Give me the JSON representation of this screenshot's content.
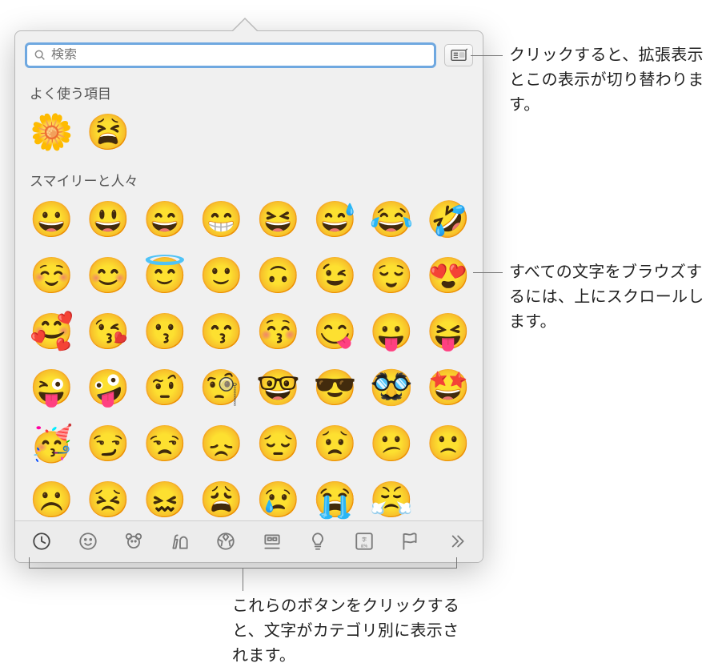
{
  "search": {
    "placeholder": "検索"
  },
  "sections": {
    "frequent": {
      "title": "よく使う項目",
      "items": [
        "🌼",
        "😫"
      ]
    },
    "smileys": {
      "title": "スマイリーと人々",
      "items": [
        "😀",
        "😃",
        "😄",
        "😁",
        "😆",
        "😅",
        "😂",
        "🤣",
        "☺️",
        "😊",
        "😇",
        "🙂",
        "🙃",
        "😉",
        "😌",
        "😍",
        "🥰",
        "😘",
        "😗",
        "😙",
        "😚",
        "😋",
        "😛",
        "😝",
        "😜",
        "🤪",
        "🤨",
        "🧐",
        "🤓",
        "😎",
        "🥸",
        "🤩",
        "🥳",
        "😏",
        "😒",
        "😞",
        "😔",
        "😟",
        "😕",
        "🙁",
        "☹️",
        "😣",
        "😖",
        "😩",
        "😢",
        "😭",
        "😤"
      ]
    }
  },
  "categories": [
    {
      "name": "recent",
      "active": true
    },
    {
      "name": "smileys",
      "active": false
    },
    {
      "name": "animals",
      "active": false
    },
    {
      "name": "food",
      "active": false
    },
    {
      "name": "activity",
      "active": false
    },
    {
      "name": "travel",
      "active": false
    },
    {
      "name": "objects",
      "active": false
    },
    {
      "name": "symbols",
      "active": false
    },
    {
      "name": "flags",
      "active": false
    },
    {
      "name": "more",
      "active": false
    }
  ],
  "annotations": {
    "expand": "クリックすると、拡張表示とこの表示が切り替わります。",
    "scroll": "すべての文字をブラウズするには、上にスクロールします。",
    "categories": "これらのボタンをクリックすると、文字がカテゴリ別に表示されます。"
  }
}
